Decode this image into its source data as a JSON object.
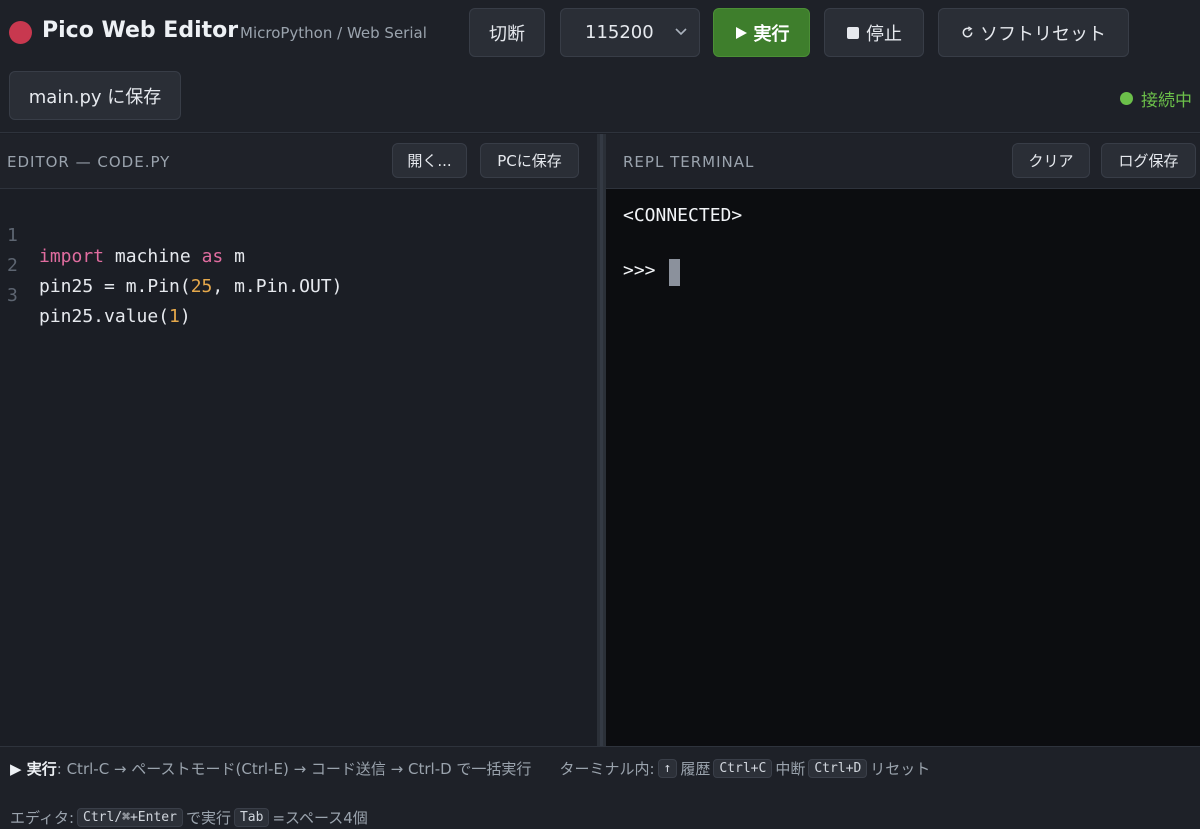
{
  "app": {
    "title": "Pico Web Editor",
    "subtitle": "MicroPython / Web Serial",
    "logo_color": "#c8384f"
  },
  "toolbar": {
    "disconnect_label": "切断",
    "baud_value": "115200",
    "run_label": "実行",
    "stop_label": "停止",
    "soft_reset_label": "ソフトリセット",
    "save_to_device_label": "main.py に保存",
    "run_icon": "play-icon",
    "stop_icon": "stop-square-icon",
    "reset_icon": "refresh-icon"
  },
  "status": {
    "label": "接続中",
    "color": "#6cc04a"
  },
  "editor": {
    "header": "EDITOR — CODE.PY",
    "open_label": "開く...",
    "save_pc_label": "PCに保存",
    "lines": [
      {
        "n": "1",
        "segments": [
          {
            "t": "import",
            "c": "kw"
          },
          {
            "t": " machine ",
            "c": ""
          },
          {
            "t": "as",
            "c": "kw"
          },
          {
            "t": " m",
            "c": ""
          }
        ]
      },
      {
        "n": "2",
        "segments": [
          {
            "t": "pin25 = m.Pin(",
            "c": ""
          },
          {
            "t": "25",
            "c": "num"
          },
          {
            "t": ", m.Pin.OUT)",
            "c": ""
          }
        ]
      },
      {
        "n": "3",
        "segments": [
          {
            "t": "pin25.value(",
            "c": ""
          },
          {
            "t": "1",
            "c": "num"
          },
          {
            "t": ")",
            "c": ""
          }
        ]
      }
    ]
  },
  "terminal": {
    "header": "REPL TERMINAL",
    "clear_label": "クリア",
    "save_log_label": "ログ保存",
    "lines": [
      "<CONNECTED>",
      "",
      ">>> "
    ]
  },
  "footer": {
    "run_title": "▶ 実行",
    "run_desc": ": Ctrl-C → ペーストモード(Ctrl-E) → コード送信 → Ctrl-D で一括実行",
    "terminal_prefix": "ターミナル内:",
    "history_key": "↑",
    "history_label": "履歴",
    "interrupt_key": "Ctrl+C",
    "interrupt_label": "中断",
    "reset_key": "Ctrl+D",
    "reset_label": "リセット",
    "editor_prefix": "エディタ:",
    "run_key": "Ctrl/⌘+Enter",
    "run_key_label": "で実行",
    "tab_key": "Tab",
    "tab_label": "=スペース4個"
  }
}
